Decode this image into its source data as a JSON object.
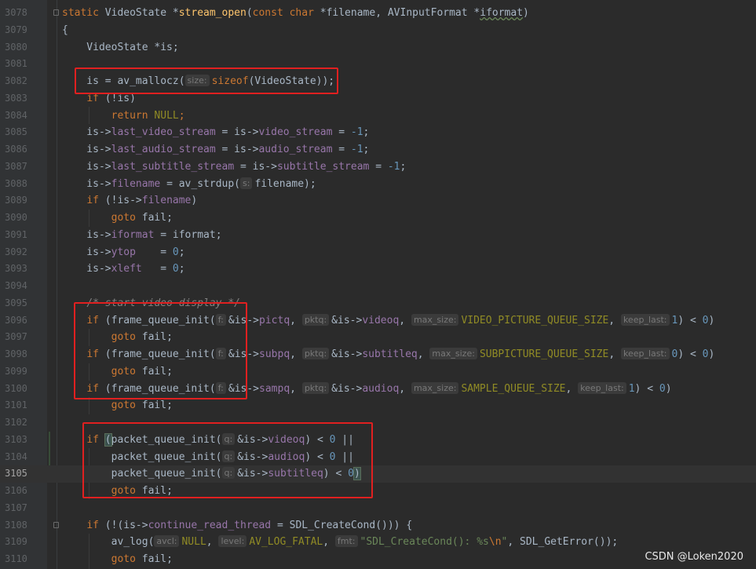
{
  "editor": {
    "lines": [
      {
        "no": "3078",
        "fold": true,
        "html": "<span class=\"kw\">static</span> VideoState *<span class=\"fn\">stream_open</span>(<span class=\"kw\">const char</span> *filename, AVInputFormat *<span style=\"text-decoration: underline wavy #6a8759;\">iformat</span>)"
      },
      {
        "no": "3079",
        "html": "{"
      },
      {
        "no": "3080",
        "html": "    VideoState *is;"
      },
      {
        "no": "3081",
        "html": ""
      },
      {
        "no": "3082",
        "html": "    is = av_mallocz(<span class=\"hint\">size:</span><span class=\"kw\">sizeof</span>(VideoState));"
      },
      {
        "no": "3083",
        "html": "    <span class=\"kw\">if</span> (!is)"
      },
      {
        "no": "3084",
        "html": "        <span class=\"kw\">return</span> <span class=\"mac\">NULL</span><span class=\"kw\">;</span>"
      },
      {
        "no": "3085",
        "html": "    is-><span class=\"fld\">last_video_stream</span> = is-><span class=\"fld\">video_stream</span> = <span class=\"num\">-1</span>;"
      },
      {
        "no": "3086",
        "html": "    is-><span class=\"fld\">last_audio_stream</span> = is-><span class=\"fld\">audio_stream</span> = <span class=\"num\">-1</span>;"
      },
      {
        "no": "3087",
        "html": "    is-><span class=\"fld\">last_subtitle_stream</span> = is-><span class=\"fld\">subtitle_stream</span> = <span class=\"num\">-1</span>;"
      },
      {
        "no": "3088",
        "html": "    is-><span class=\"fld\">filename</span> = av_strdup(<span class=\"hint\">s:</span>filename);"
      },
      {
        "no": "3089",
        "html": "    <span class=\"kw\">if</span> (!is-><span class=\"fld\">filename</span>)"
      },
      {
        "no": "3090",
        "html": "        <span class=\"kw\">goto</span> fail;"
      },
      {
        "no": "3091",
        "html": "    is-><span class=\"fld\">iformat</span> = iformat;"
      },
      {
        "no": "3092",
        "html": "    is-><span class=\"fld\">ytop</span>    = <span class=\"num\">0</span>;"
      },
      {
        "no": "3093",
        "html": "    is-><span class=\"fld\">xleft</span>   = <span class=\"num\">0</span>;"
      },
      {
        "no": "3094",
        "html": ""
      },
      {
        "no": "3095",
        "html": "    <span class=\"cmt\">/* start video display */</span>"
      },
      {
        "no": "3096",
        "html": "    <span class=\"kw\">if</span> (frame_queue_init(<span class=\"hint\">f:</span>&amp;is-><span class=\"fld\">pictq</span>, <span class=\"hint\">pktq:</span>&amp;is-><span class=\"fld\">videoq</span>, <span class=\"hint\">max_size:</span><span class=\"mac\">VIDEO_PICTURE_QUEUE_SIZE</span>, <span class=\"hint\">keep_last:</span><span class=\"num\">1</span>) &lt; <span class=\"num\">0</span>)"
      },
      {
        "no": "3097",
        "html": "        <span class=\"kw\">goto</span> fail;"
      },
      {
        "no": "3098",
        "html": "    <span class=\"kw\">if</span> (frame_queue_init(<span class=\"hint\">f:</span>&amp;is-><span class=\"fld\">subpq</span>, <span class=\"hint\">pktq:</span>&amp;is-><span class=\"fld\">subtitleq</span>, <span class=\"hint\">max_size:</span><span class=\"mac\">SUBPICTURE_QUEUE_SIZE</span>, <span class=\"hint\">keep_last:</span><span class=\"num\">0</span>) &lt; <span class=\"num\">0</span>)"
      },
      {
        "no": "3099",
        "html": "        <span class=\"kw\">goto</span> fail;"
      },
      {
        "no": "3100",
        "html": "    <span class=\"kw\">if</span> (frame_queue_init(<span class=\"hint\">f:</span>&amp;is-><span class=\"fld\">sampq</span>, <span class=\"hint\">pktq:</span>&amp;is-><span class=\"fld\">audioq</span>, <span class=\"hint\">max_size:</span><span class=\"mac\">SAMPLE_QUEUE_SIZE</span>, <span class=\"hint\">keep_last:</span><span class=\"num\">1</span>) &lt; <span class=\"num\">0</span>)"
      },
      {
        "no": "3101",
        "html": "        <span class=\"kw\">goto</span> fail;"
      },
      {
        "no": "3102",
        "html": ""
      },
      {
        "no": "3103",
        "html": "    <span class=\"kw\">if</span> <span class=\"brace-hl\">(</span>packet_queue_init(<span class=\"hint\">q:</span>&amp;is-><span class=\"fld\">videoq</span>) &lt; <span class=\"num\">0</span> ||"
      },
      {
        "no": "3104",
        "html": "        packet_queue_init(<span class=\"hint\">q:</span>&amp;is-><span class=\"fld\">audioq</span>) &lt; <span class=\"num\">0</span> ||"
      },
      {
        "no": "3105",
        "current": true,
        "html": "        packet_queue_init(<span class=\"hint\">q:</span>&amp;is-><span class=\"fld\">subtitleq</span>) &lt; <span class=\"num\">0</span><span class=\"brace-hl\">)</span>"
      },
      {
        "no": "3106",
        "html": "        <span class=\"kw\">goto</span> fail;"
      },
      {
        "no": "3107",
        "html": ""
      },
      {
        "no": "3108",
        "fold": true,
        "html": "    <span class=\"kw\">if</span> (!(is-><span class=\"fld\">continue_read_thread</span> = SDL_CreateCond())) {"
      },
      {
        "no": "3109",
        "html": "        av_log(<span class=\"hint\">avcl:</span><span class=\"mac\">NULL</span>, <span class=\"hint\">level:</span><span class=\"mac\">AV_LOG_FATAL</span>, <span class=\"hint\">fmt:</span><span class=\"str\">\"SDL_CreateCond(): %s<span class=\"esc\">\\n</span>\"</span>, SDL_GetError());"
      },
      {
        "no": "3110",
        "html": "        <span class=\"kw\">goto</span> fail;"
      }
    ]
  },
  "watermark": "CSDN @Loken2020"
}
